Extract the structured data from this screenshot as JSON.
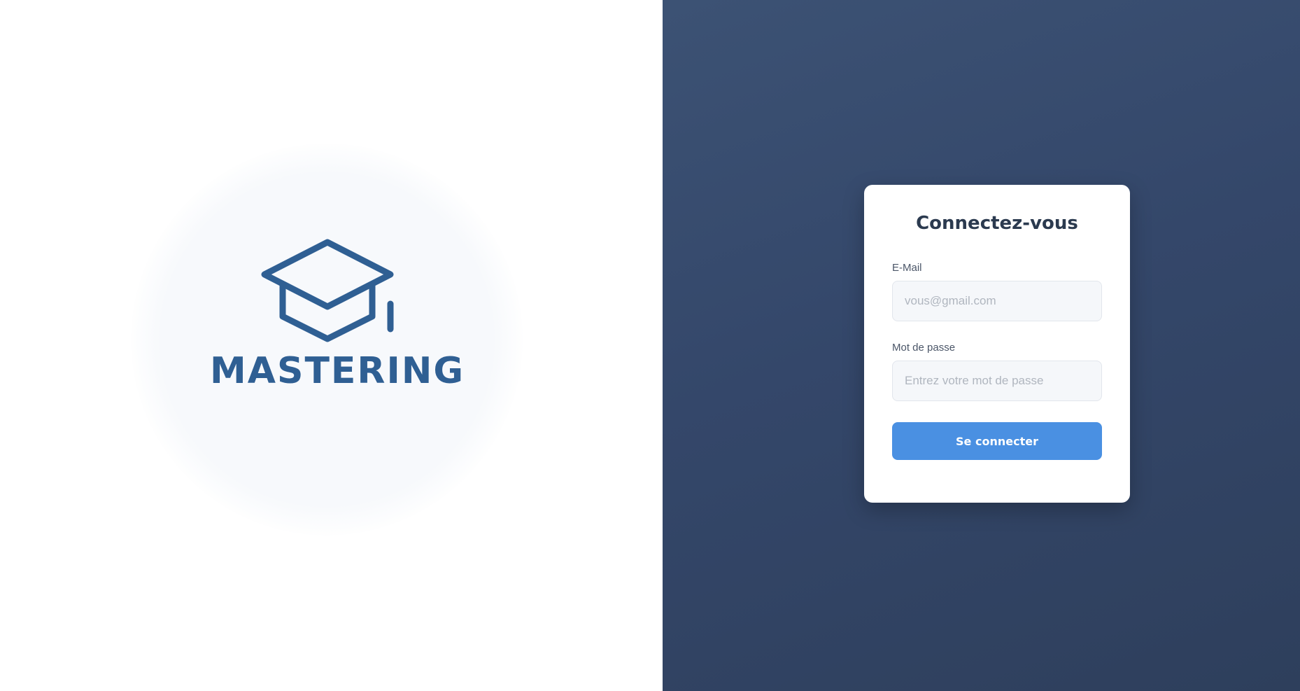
{
  "brand": {
    "name": "MASTERING",
    "logo_icon": "graduation-cap-icon",
    "color": "#2f5f93"
  },
  "login": {
    "title": "Connectez-vous",
    "email": {
      "label": "E-Mail",
      "placeholder": "vous@gmail.com",
      "value": ""
    },
    "password": {
      "label": "Mot de passe",
      "placeholder": "Entrez votre mot de passe",
      "value": ""
    },
    "submit_label": "Se connecter",
    "accent_color": "#4a90e2"
  }
}
